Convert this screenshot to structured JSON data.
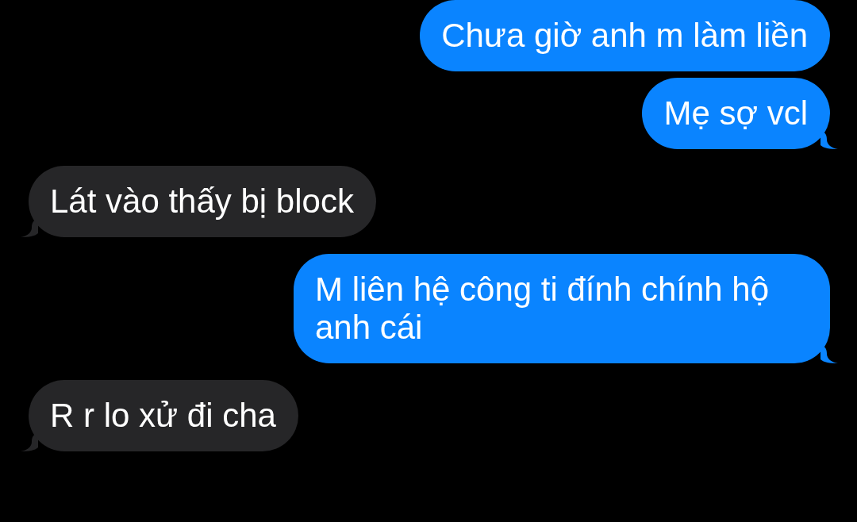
{
  "messages": [
    {
      "kind": "sent",
      "text": "Chưa giờ anh m làm liền",
      "tail": false
    },
    {
      "kind": "sent",
      "text": "Mẹ sợ vcl",
      "tail": true
    },
    {
      "kind": "received",
      "text": "Lát vào thấy bị block",
      "tail": true
    },
    {
      "kind": "sent",
      "text": "M liên hệ công ti đính chính hộ anh cái",
      "tail": true
    },
    {
      "kind": "received",
      "text": "R r lo xử đi cha",
      "tail": true
    }
  ]
}
